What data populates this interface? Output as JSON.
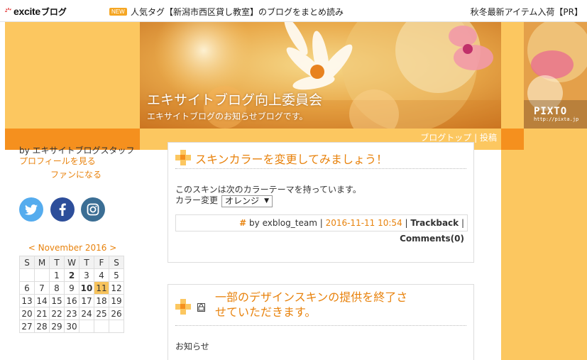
{
  "topbar": {
    "logo_text": "excite",
    "logo_suffix": "ブログ",
    "new_badge": "NEW",
    "headline": "人気タグ【新潟市西区貸し教室】のブログをまとめ読み",
    "pr_text": "秋冬最新アイテム入荷【PR】"
  },
  "header": {
    "blog_title": "エキサイトブログ向上委員会",
    "blog_subtitle": "エキサイトブログのお知らせブログです。",
    "pixta_logo": "PIXTO",
    "pixta_url": "http://pixta.jp",
    "nav_top": "ブログトップ",
    "nav_sep": " | ",
    "nav_post": "投稿"
  },
  "sidebar": {
    "by_line": "by エキサイトブログスタッフ",
    "profile_link": "プロフィールを見る",
    "fan_link": "ファンになる",
    "social": {
      "twitter": "twitter-icon",
      "facebook": "facebook-icon",
      "instagram": "instagram-icon"
    },
    "calendar": {
      "prev": "<",
      "month_label": "November 2016",
      "next": ">",
      "weekdays": [
        "S",
        "M",
        "T",
        "W",
        "T",
        "F",
        "S"
      ],
      "weeks": [
        [
          "",
          "",
          "1",
          "2",
          "3",
          "4",
          "5"
        ],
        [
          "6",
          "7",
          "8",
          "9",
          "10",
          "11",
          "12"
        ],
        [
          "13",
          "14",
          "15",
          "16",
          "17",
          "18",
          "19"
        ],
        [
          "20",
          "21",
          "22",
          "23",
          "24",
          "25",
          "26"
        ],
        [
          "27",
          "28",
          "29",
          "30",
          "",
          "",
          ""
        ]
      ],
      "today": "11"
    }
  },
  "posts": [
    {
      "title": "スキンカラーを変更してみましょう！",
      "body_line1": "このスキンは次のカラーテーマを持っています。",
      "color_label": "カラー変更",
      "select_value": "オレンジ",
      "meta": {
        "hash": "#",
        "by": " by exblog_team",
        "sep1": " | ",
        "date": "2016-11-11 10:54",
        "sep2": " | ",
        "trackback": "Trackback",
        "sep3": " | ",
        "comments": "Comments(0)"
      }
    },
    {
      "title_line1": "一部のデザインスキンの提供を終了さ",
      "title_line2": "せていただきます。",
      "lock_icon": "lock-icon",
      "body_line1": "お知らせ"
    }
  ],
  "colors": {
    "accent_orange": "#f5901e",
    "light_orange": "#fcc760",
    "link_orange": "#e8820c"
  }
}
